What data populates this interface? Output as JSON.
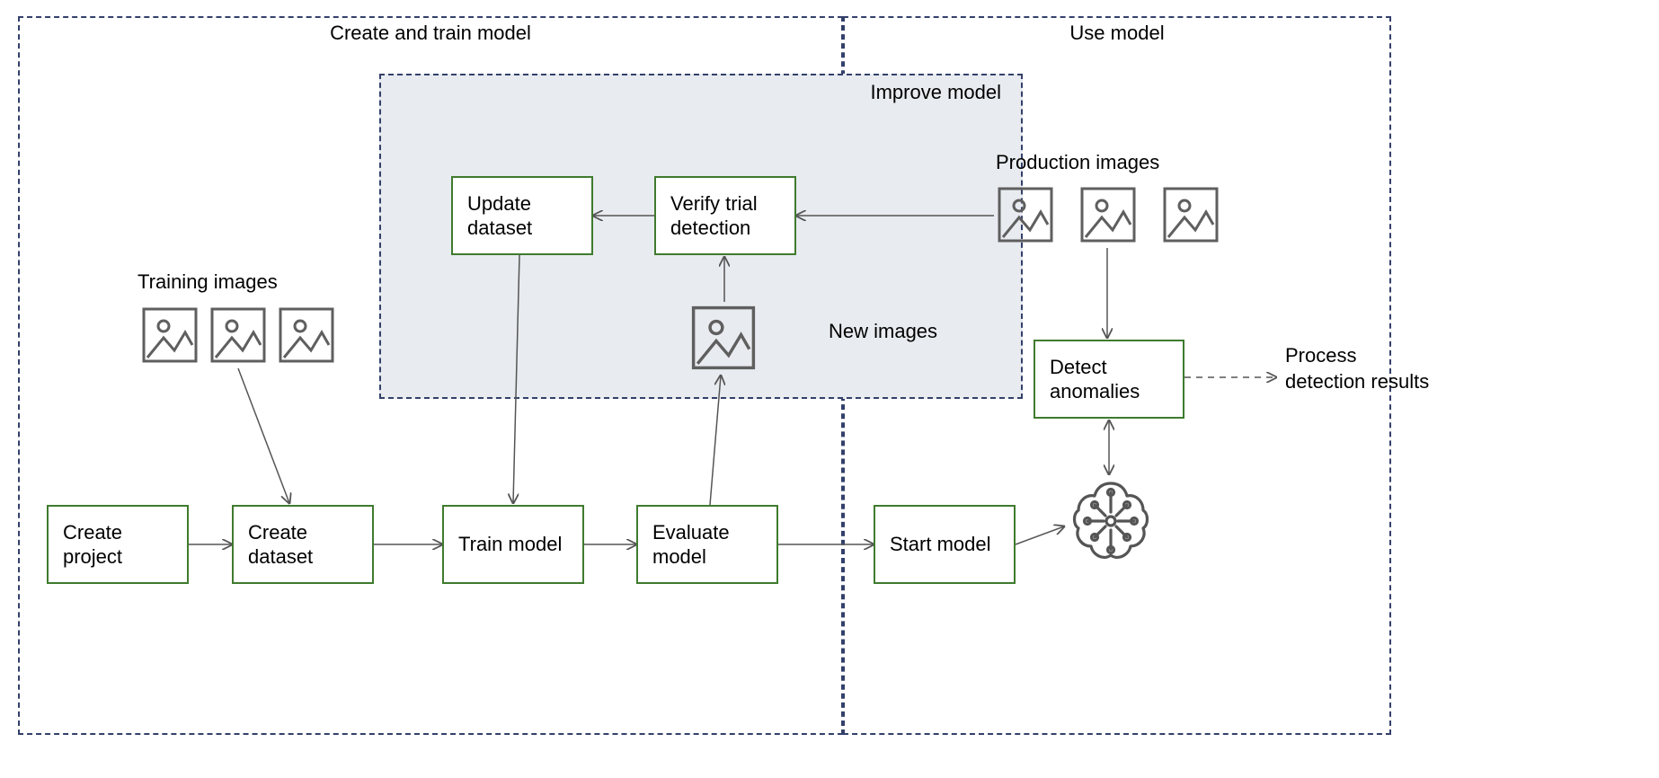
{
  "regions": {
    "create_train": {
      "label": "Create and train model"
    },
    "use_model": {
      "label": "Use model"
    },
    "improve": {
      "label": "Improve model"
    }
  },
  "nodes": {
    "create_project": {
      "label": "Create project"
    },
    "create_dataset": {
      "label": "Create dataset"
    },
    "train_model": {
      "label": "Train model"
    },
    "evaluate_model": {
      "label": "Evaluate model"
    },
    "update_dataset": {
      "label": "Update dataset"
    },
    "verify_trial": {
      "label": "Verify trial detection"
    },
    "start_model": {
      "label": "Start model"
    },
    "detect_anomalies": {
      "label": "Detect anomalies"
    },
    "process_results": {
      "label": "Process detection results"
    }
  },
  "labels": {
    "training_images": "Training images",
    "new_images": "New images",
    "production_images": "Production images"
  }
}
